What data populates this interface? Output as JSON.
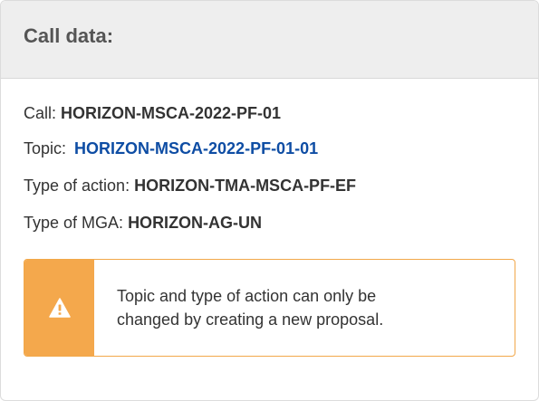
{
  "header": {
    "title": "Call data:"
  },
  "call": {
    "label": "Call:",
    "value": "HORIZON-MSCA-2022-PF-01"
  },
  "topic": {
    "label": "Topic:",
    "value": "HORIZON-MSCA-2022-PF-01-01"
  },
  "type_of_action": {
    "label": "Type of action:",
    "value": "HORIZON-TMA-MSCA-PF-EF"
  },
  "type_of_mga": {
    "label": "Type of MGA:",
    "value": "HORIZON-AG-UN"
  },
  "warning": {
    "icon": "warning-triangle-icon",
    "line1": "Topic and type of action can only be",
    "line2": "changed by creating a new proposal.",
    "accent_color": "#f4a84c",
    "border_color": "#f2a84a"
  },
  "colors": {
    "link": "#0e4da4",
    "header_bg": "#eeeeee"
  }
}
